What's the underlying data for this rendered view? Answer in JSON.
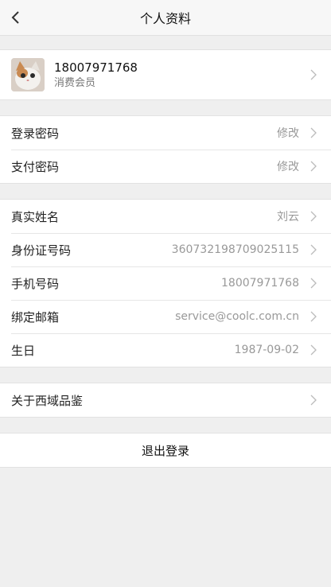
{
  "header": {
    "title": "个人资料"
  },
  "profile": {
    "phone": "18007971768",
    "member_type": "消费会员"
  },
  "security": [
    {
      "label": "登录密码",
      "value": "修改"
    },
    {
      "label": "支付密码",
      "value": "修改"
    }
  ],
  "info": [
    {
      "label": "真实姓名",
      "value": "刘云"
    },
    {
      "label": "身份证号码",
      "value": "360732198709025115"
    },
    {
      "label": "手机号码",
      "value": "18007971768"
    },
    {
      "label": "绑定邮箱",
      "value": "service@coolc.com.cn"
    },
    {
      "label": "生日",
      "value": "1987-09-02"
    }
  ],
  "about": {
    "label": "关于西域品鉴"
  },
  "logout": {
    "label": "退出登录"
  }
}
